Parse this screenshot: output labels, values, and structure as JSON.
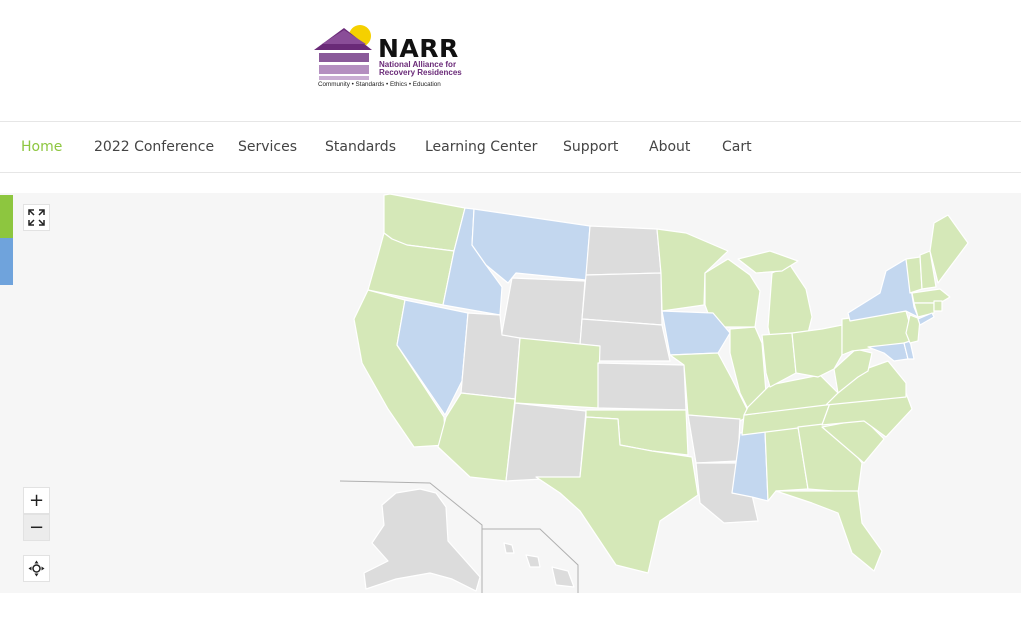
{
  "logo": {
    "title": "NARR",
    "subtitle": "National Alliance for Recovery Residences",
    "tagline": "Community • Standards • Ethics • Education",
    "colors": {
      "purple": "#6a2a78",
      "light_purple": "#b48fc0",
      "sun": "#f5d000"
    }
  },
  "nav": {
    "items": [
      {
        "label": "Home",
        "active": true
      },
      {
        "label": "2022 Conference",
        "active": false
      },
      {
        "label": "Services",
        "active": false
      },
      {
        "label": "Standards",
        "active": false
      },
      {
        "label": "Learning Center",
        "active": false
      },
      {
        "label": "Support",
        "active": false
      },
      {
        "label": "About",
        "active": false
      },
      {
        "label": "Cart",
        "active": false
      }
    ],
    "active_color": "#8dc63f"
  },
  "map": {
    "state_colors": {
      "green": "#d5e8b8",
      "blue": "#c3d7ef",
      "gray": "#dcdcdc"
    },
    "legend_tab_colors": [
      "#8dc63f",
      "#6fa3dc"
    ],
    "controls": {
      "fullscreen_icon": "expand-arrows-icon",
      "zoom_in": "+",
      "zoom_out": "−",
      "recenter_icon": "recenter-crosshair-icon"
    }
  }
}
